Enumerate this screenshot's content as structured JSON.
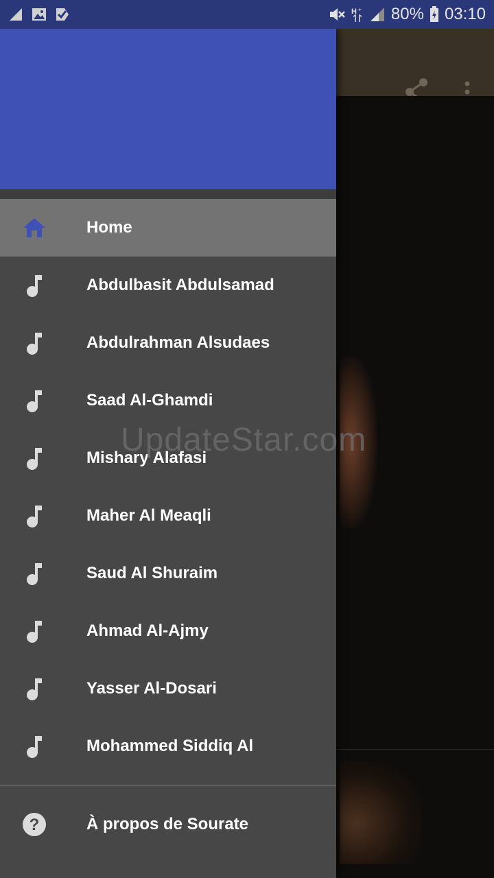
{
  "status_bar": {
    "battery": "80%",
    "time": "03:10",
    "icons": [
      "signal-unknown-icon",
      "image-icon",
      "check-flag-icon",
      "mute-icon",
      "h-plus-icon",
      "signal-icon",
      "battery-icon"
    ]
  },
  "toolbar": {
    "icons": [
      "share-icon",
      "more-vert-icon"
    ]
  },
  "drawer": {
    "header_color": "#3f51b5",
    "items": [
      {
        "label": "Home",
        "icon": "home-icon"
      },
      {
        "label": "Abdulbasit Abdulsamad",
        "icon": "music-note-icon"
      },
      {
        "label": "Abdulrahman Alsudaes",
        "icon": "music-note-icon"
      },
      {
        "label": "Saad Al-Ghamdi",
        "icon": "music-note-icon"
      },
      {
        "label": "Mishary Alafasi",
        "icon": "music-note-icon"
      },
      {
        "label": "Maher Al Meaqli",
        "icon": "music-note-icon"
      },
      {
        "label": "Saud Al Shuraim",
        "icon": "music-note-icon"
      },
      {
        "label": "Ahmad Al-Ajmy",
        "icon": "music-note-icon"
      },
      {
        "label": "Yasser Al-Dosari",
        "icon": "music-note-icon"
      },
      {
        "label": "Mohammed Siddiq Al",
        "icon": "music-note-icon"
      }
    ],
    "about": {
      "label": "À propos de Sourate",
      "icon": "help-icon"
    }
  },
  "watermark": "UpdateStar.com"
}
